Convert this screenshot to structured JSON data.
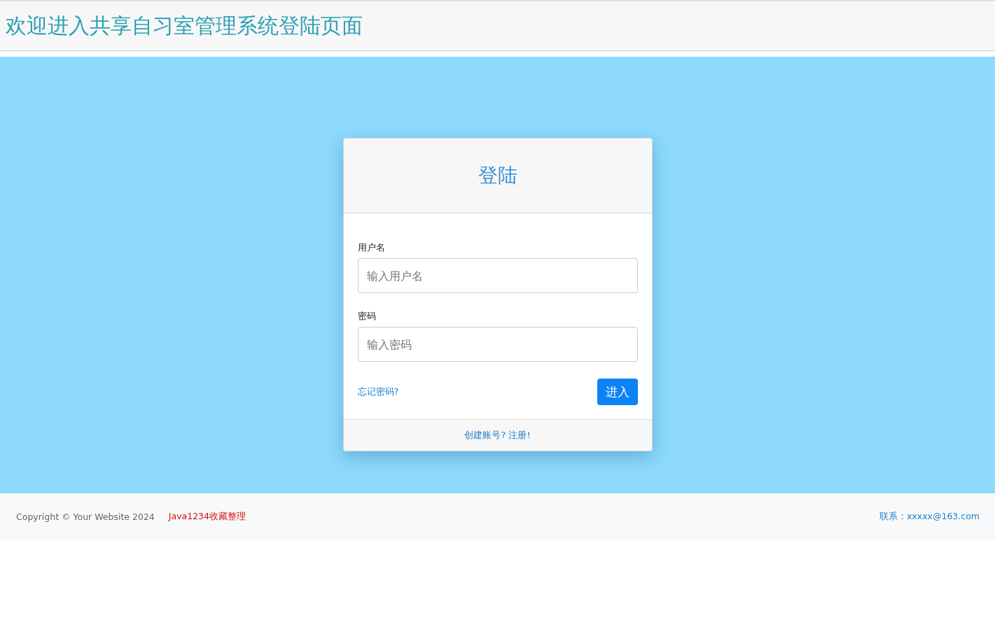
{
  "header": {
    "title": "欢迎进入共享自习室管理系统登陆页面"
  },
  "login_card": {
    "title": "登陆",
    "fields": [
      {
        "label": "用户名",
        "placeholder": "输入用户名"
      },
      {
        "label": "密码",
        "placeholder": "输入密码"
      }
    ],
    "forgot_link": "忘记密码?",
    "submit_button": "进入",
    "register_link": "创建账号? 注册!"
  },
  "footer": {
    "copyright": "Copyright © Your Website 2024",
    "credit": "Java1234收藏整理",
    "contact": "联系：xxxxx@163.com"
  }
}
